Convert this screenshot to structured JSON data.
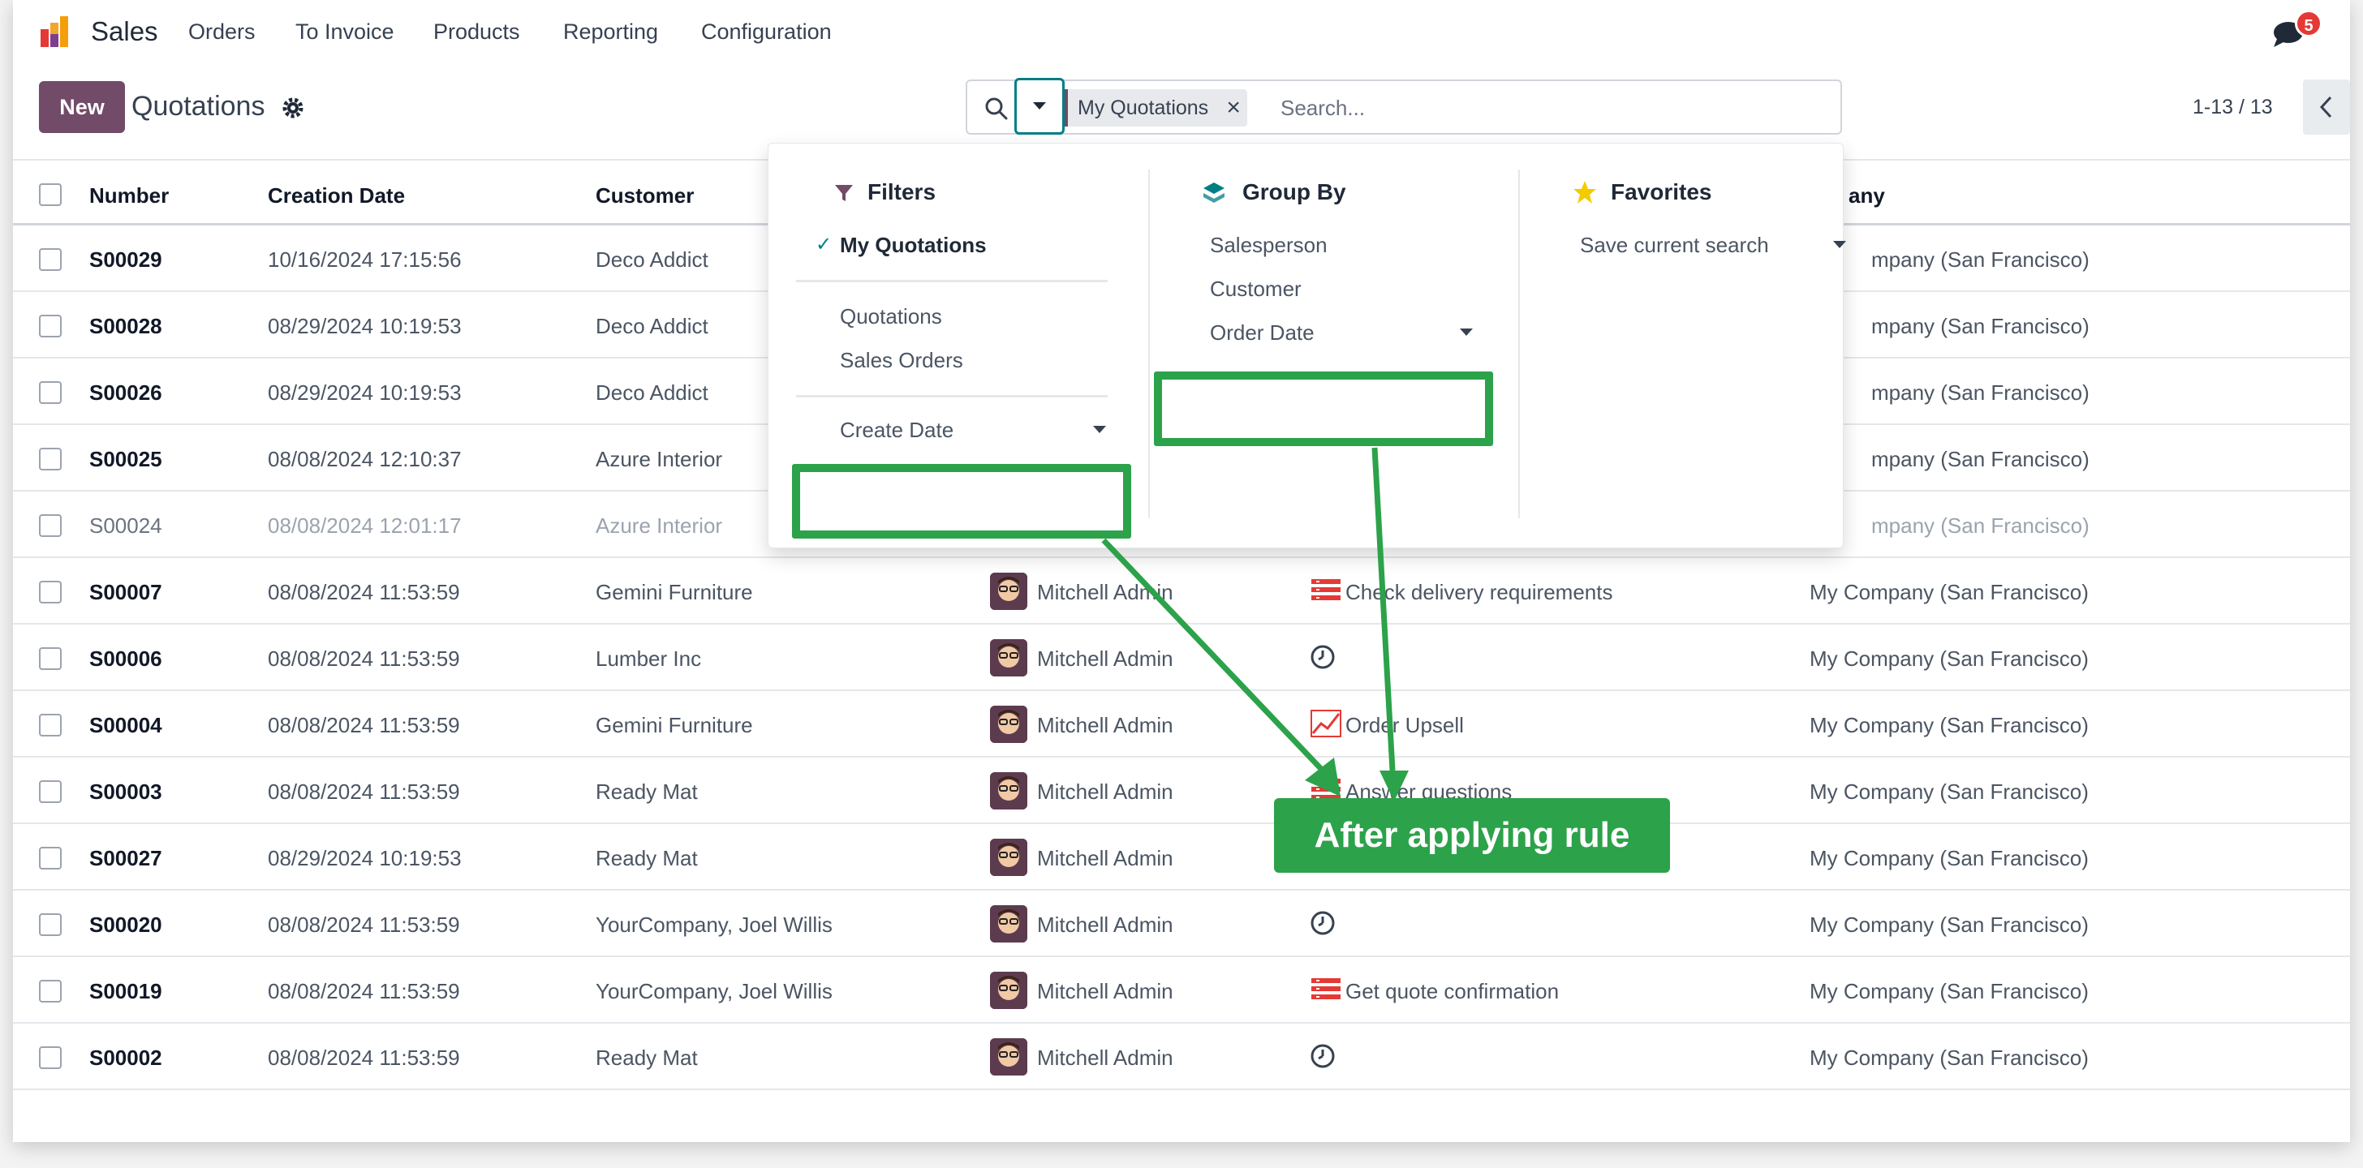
{
  "app": {
    "name": "Sales",
    "chat_badge": "5"
  },
  "nav": {
    "items": [
      "Orders",
      "To Invoice",
      "Products",
      "Reporting",
      "Configuration"
    ]
  },
  "control": {
    "new_label": "New",
    "title": "Quotations",
    "pager": "1-13 / 13"
  },
  "search": {
    "facet": "My Quotations",
    "placeholder": "Search..."
  },
  "columns": {
    "number": "Number",
    "created": "Creation Date",
    "customer": "Customer",
    "company": "any"
  },
  "rows": [
    {
      "number": "S00029",
      "date": "10/16/2024 17:15:56",
      "customer": "Deco Addict",
      "salesperson": "",
      "activity": "",
      "company": "mpany (San Francisco)"
    },
    {
      "number": "S00028",
      "date": "08/29/2024 10:19:53",
      "customer": "Deco Addict",
      "salesperson": "",
      "activity": "",
      "company": "mpany (San Francisco)"
    },
    {
      "number": "S00026",
      "date": "08/29/2024 10:19:53",
      "customer": "Deco Addict",
      "salesperson": "",
      "activity": "",
      "company": "mpany (San Francisco)"
    },
    {
      "number": "S00025",
      "date": "08/08/2024 12:10:37",
      "customer": "Azure Interior",
      "salesperson": "",
      "activity": "",
      "company": "mpany (San Francisco)"
    },
    {
      "number": "S00024",
      "date": "08/08/2024 12:01:17",
      "customer": "Azure Interior",
      "salesperson": "",
      "activity": "",
      "company": "mpany (San Francisco)"
    },
    {
      "number": "S00007",
      "date": "08/08/2024 11:53:59",
      "customer": "Gemini Furniture",
      "salesperson": "Mitchell Admin",
      "activity": "Check delivery requirements",
      "company": "My Company (San Francisco)"
    },
    {
      "number": "S00006",
      "date": "08/08/2024 11:53:59",
      "customer": "Lumber Inc",
      "salesperson": "Mitchell Admin",
      "activity": "",
      "company": "My Company (San Francisco)"
    },
    {
      "number": "S00004",
      "date": "08/08/2024 11:53:59",
      "customer": "Gemini Furniture",
      "salesperson": "Mitchell Admin",
      "activity": "Order Upsell",
      "company": "My Company (San Francisco)"
    },
    {
      "number": "S00003",
      "date": "08/08/2024 11:53:59",
      "customer": "Ready Mat",
      "salesperson": "Mitchell Admin",
      "activity": "Answer questions",
      "company": "My Company (San Francisco)"
    },
    {
      "number": "S00027",
      "date": "08/29/2024 10:19:53",
      "customer": "Ready Mat",
      "salesperson": "Mitchell Admin",
      "activity": "",
      "company": "My Company (San Francisco)"
    },
    {
      "number": "S00020",
      "date": "08/08/2024 11:53:59",
      "customer": "YourCompany, Joel Willis",
      "salesperson": "Mitchell Admin",
      "activity": "",
      "company": "My Company (San Francisco)"
    },
    {
      "number": "S00019",
      "date": "08/08/2024 11:53:59",
      "customer": "YourCompany, Joel Willis",
      "salesperson": "Mitchell Admin",
      "activity": "Get quote confirmation",
      "company": "My Company (San Francisco)"
    },
    {
      "number": "S00002",
      "date": "08/08/2024 11:53:59",
      "customer": "Ready Mat",
      "salesperson": "Mitchell Admin",
      "activity": "",
      "company": "My Company (San Francisco)"
    }
  ],
  "dropdown": {
    "filters_title": "Filters",
    "filters": [
      "My Quotations",
      "Quotations",
      "Sales Orders",
      "Create Date"
    ],
    "groupby_title": "Group By",
    "groupby": [
      "Salesperson",
      "Customer",
      "Order Date"
    ],
    "favorites_title": "Favorites",
    "favorites": [
      "Save current search"
    ]
  },
  "annotation": {
    "callout": "After applying rule"
  },
  "colors": {
    "brand": "#714b67",
    "highlight": "#2ca24a",
    "teal": "#017e84",
    "activity_red": "#e53935"
  }
}
